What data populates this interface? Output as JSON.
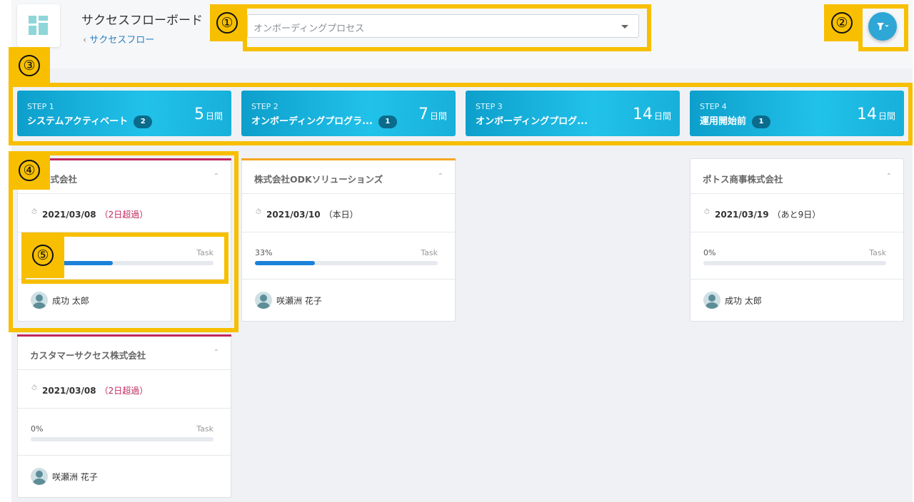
{
  "header": {
    "title": "サクセスフローボード",
    "breadcrumb": "サクセスフロー",
    "process_select_value": "オンボーディングプロセス"
  },
  "icons": {
    "logo": "grid-logo-icon",
    "back": "chevron-left-icon",
    "select_caret": "caret-down-icon",
    "filter": "filter-icon",
    "due": "clock-icon",
    "collapse": "chevron-up-icon",
    "avatar": "user-avatar-icon"
  },
  "callouts": [
    "①",
    "②",
    "③",
    "④",
    "⑤"
  ],
  "colors": {
    "callout": "#f7bf00",
    "step_gradient_start": "#0d9fcb",
    "step_gradient_end": "#21c2ea",
    "overdue": "#c0275f",
    "progress_fill": "#1a82d8",
    "card_bar_overdue": "#c0275f",
    "card_bar_warning": "#f5a623"
  },
  "steps": [
    {
      "label": "STEP 1",
      "name": "システムアクティベート",
      "count": "2",
      "days": "5",
      "unit": "日間"
    },
    {
      "label": "STEP 2",
      "name": "オンボーディングプログラ...",
      "count": "1",
      "days": "7",
      "unit": "日間"
    },
    {
      "label": "STEP 3",
      "name": "オンボーディングプログ...",
      "count": "",
      "days": "14",
      "unit": "日間"
    },
    {
      "label": "STEP 4",
      "name": "運用開始前",
      "count": "1",
      "days": "14",
      "unit": "日間"
    }
  ],
  "cards": [
    {
      "company": "os株式会社",
      "date": "2021/03/08",
      "note": "（2日超過）",
      "overdue": true,
      "progress": 0.45,
      "percent": "",
      "task": "Task",
      "assignee": "成功 太郎"
    },
    {
      "company": "株式会社ODKソリューションズ",
      "date": "2021/03/10",
      "note": "（本日）",
      "overdue": false,
      "progress": 0.33,
      "percent": "33%",
      "task": "Task",
      "assignee": "咲瀬洲 花子"
    },
    {
      "company": "ポトス商事株式会社",
      "date": "2021/03/19",
      "note": "（あと9日）",
      "overdue": false,
      "progress": 0,
      "percent": "0%",
      "task": "Task",
      "assignee": "成功 太郎"
    },
    {
      "company": "カスタマーサクセス株式会社",
      "date": "2021/03/08",
      "note": "（2日超過）",
      "overdue": true,
      "progress": 0,
      "percent": "0%",
      "task": "Task",
      "assignee": "咲瀬洲 花子"
    }
  ]
}
